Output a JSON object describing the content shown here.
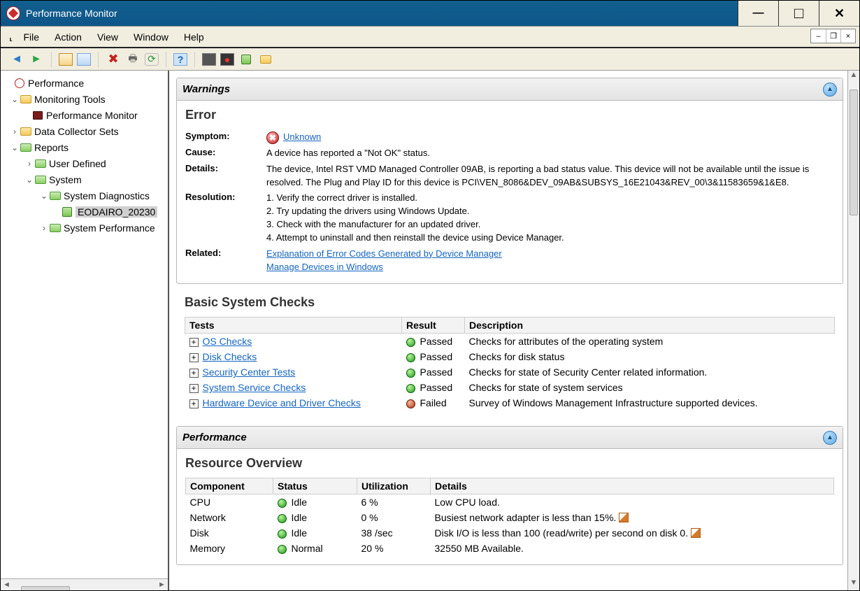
{
  "window": {
    "title": "Performance Monitor"
  },
  "menu": {
    "file": "File",
    "action": "Action",
    "view": "View",
    "window": "Window",
    "help": "Help"
  },
  "tree": {
    "root": "Performance",
    "mtools": "Monitoring Tools",
    "pmon": "Performance Monitor",
    "dcs": "Data Collector Sets",
    "reports": "Reports",
    "ud": "User Defined",
    "system": "System",
    "sysdiag": "System Diagnostics",
    "selected": "EODAIRO_20230",
    "sysperf": "System Performance"
  },
  "warnings": {
    "title": "Warnings",
    "error_title": "Error",
    "symptom_label": "Symptom:",
    "symptom_value": "Unknown",
    "cause_label": "Cause:",
    "cause_value": "A device has reported a \"Not OK\" status.",
    "details_label": "Details:",
    "details_value": "The device, Intel RST VMD Managed Controller 09AB, is reporting a bad status value. This device will not be available until the issue is resolved. The Plug and Play ID for this device is PCI\\VEN_8086&DEV_09AB&SUBSYS_16E21043&REV_00\\3&11583659&1&E8.",
    "resolution_label": "Resolution:",
    "res1": "1. Verify the correct driver is installed.",
    "res2": "2. Try updating the drivers using Windows Update.",
    "res3": "3. Check with the manufacturer for an updated driver.",
    "res4": "4. Attempt to uninstall and then reinstall the device using Device Manager.",
    "related_label": "Related:",
    "related1": "Explanation of Error Codes Generated by Device Manager",
    "related2": "Manage Devices in Windows"
  },
  "checks": {
    "title": "Basic System Checks",
    "th_tests": "Tests",
    "th_result": "Result",
    "th_desc": "Description",
    "rows": [
      {
        "name": "OS Checks",
        "result": "Passed",
        "led": "g",
        "desc": "Checks for attributes of the operating system"
      },
      {
        "name": "Disk Checks",
        "result": "Passed",
        "led": "g",
        "desc": "Checks for disk status"
      },
      {
        "name": "Security Center Tests",
        "result": "Passed",
        "led": "g",
        "desc": "Checks for state of Security Center related information."
      },
      {
        "name": "System Service Checks",
        "result": "Passed",
        "led": "g",
        "desc": "Checks for state of system services"
      },
      {
        "name": "Hardware Device and Driver Checks",
        "result": "Failed",
        "led": "r",
        "desc": "Survey of Windows Management Infrastructure supported devices."
      }
    ]
  },
  "perf": {
    "title": "Performance",
    "overview_title": "Resource Overview",
    "th_comp": "Component",
    "th_status": "Status",
    "th_util": "Utilization",
    "th_det": "Details",
    "rows": [
      {
        "comp": "CPU",
        "led": "g",
        "status": "Idle",
        "util": "6 %",
        "det": "Low CPU load.",
        "edit": false
      },
      {
        "comp": "Network",
        "led": "g",
        "status": "Idle",
        "util": "0 %",
        "det": "Busiest network adapter is less than 15%.",
        "edit": true
      },
      {
        "comp": "Disk",
        "led": "g",
        "status": "Idle",
        "util": "38 /sec",
        "det": "Disk I/O is less than 100 (read/write) per second on disk 0.",
        "edit": true
      },
      {
        "comp": "Memory",
        "led": "g",
        "status": "Normal",
        "util": "20 %",
        "det": "32550 MB Available.",
        "edit": false
      }
    ]
  }
}
